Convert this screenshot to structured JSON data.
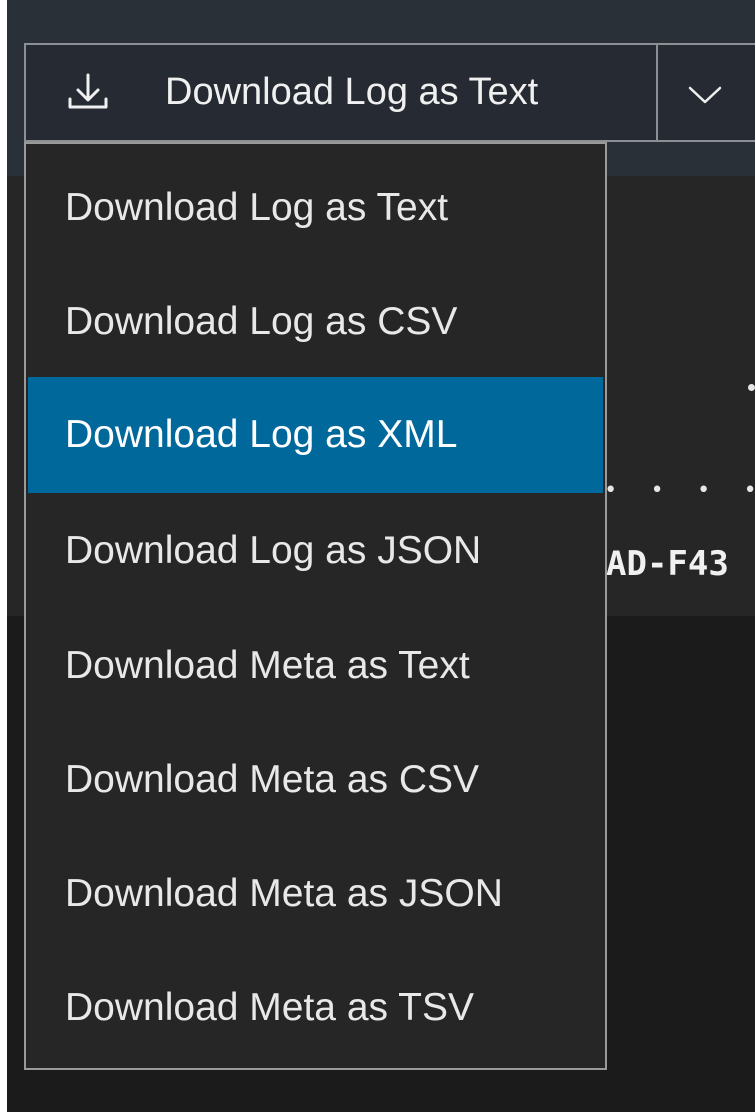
{
  "toolbar": {
    "download_button_label": "Download Log as Text",
    "download_icon": "download-icon",
    "toggle_icon": "chevron-down-icon"
  },
  "menu": {
    "items": [
      {
        "label": "Download Log as Text",
        "selected": false
      },
      {
        "label": "Download Log as CSV",
        "selected": false
      },
      {
        "label": "Download Log as XML",
        "selected": true
      },
      {
        "label": "Download Log as JSON",
        "selected": false
      },
      {
        "label": "Download Meta as Text",
        "selected": false
      },
      {
        "label": "Download Meta as CSV",
        "selected": false
      },
      {
        "label": "Download Meta as JSON",
        "selected": false
      },
      {
        "label": "Download Meta as TSV",
        "selected": false
      }
    ]
  },
  "background": {
    "dots": "• • • • • •",
    "log_fragment": "AD-F43"
  },
  "colors": {
    "selected_item": "#00689a",
    "menu_background": "#262626",
    "toolbar_background": "#2a3038"
  }
}
